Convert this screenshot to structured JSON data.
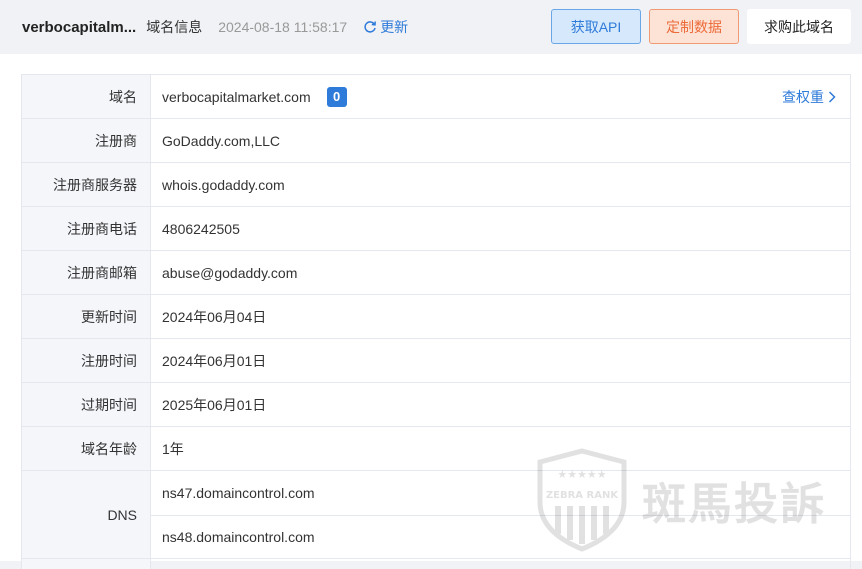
{
  "header": {
    "domain_title": "verbocapitalm...",
    "tab_label": "域名信息",
    "timestamp": "2024-08-18 11:58:17",
    "refresh_label": "更新",
    "api_button": "获取API",
    "custom_button": "定制数据",
    "buy_button": "求购此域名"
  },
  "table": {
    "domain": {
      "label": "域名",
      "value": "verbocapitalmarket.com",
      "badge": "0",
      "link": "查权重"
    },
    "rows": [
      {
        "label": "注册商",
        "value": "GoDaddy.com,LLC"
      },
      {
        "label": "注册商服务器",
        "value": "whois.godaddy.com"
      },
      {
        "label": "注册商电话",
        "value": "4806242505"
      },
      {
        "label": "注册商邮箱",
        "value": "abuse@godaddy.com"
      },
      {
        "label": "更新时间",
        "value": "2024年06月04日"
      },
      {
        "label": "注册时间",
        "value": "2024年06月01日"
      },
      {
        "label": "过期时间",
        "value": "2025年06月01日"
      },
      {
        "label": "域名年龄",
        "value": "1年"
      }
    ],
    "dns": {
      "label": "DNS",
      "values": [
        "ns47.domaincontrol.com",
        "ns48.domaincontrol.com"
      ]
    }
  },
  "watermark": {
    "badge_text": "ZEBRA RANK",
    "text": "斑馬投訴"
  },
  "colors": {
    "accent": "#2f7bd9",
    "orange": "#ec6c39",
    "label_bg": "#f4f6fa",
    "border": "#e4e7ed"
  }
}
